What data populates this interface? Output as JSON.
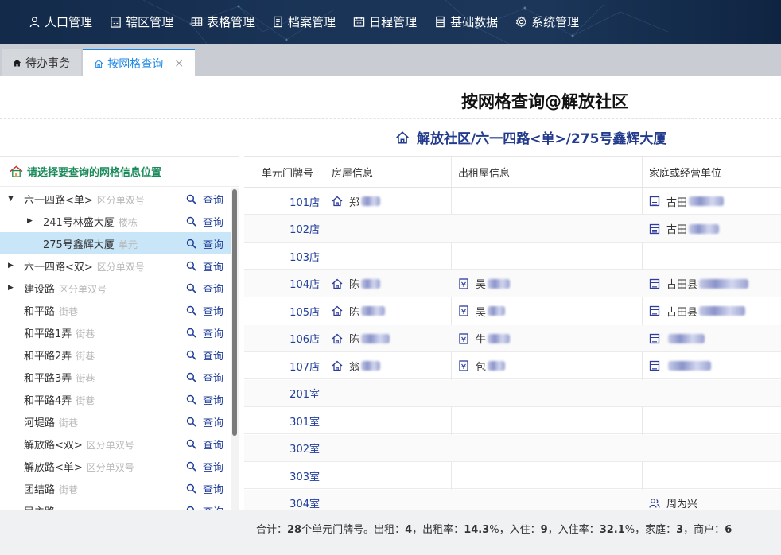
{
  "nav": {
    "items": [
      {
        "label": "人口管理",
        "icon": "person-icon"
      },
      {
        "label": "辖区管理",
        "icon": "building-icon"
      },
      {
        "label": "表格管理",
        "icon": "table-icon"
      },
      {
        "label": "档案管理",
        "icon": "file-icon"
      },
      {
        "label": "日程管理",
        "icon": "calendar-icon"
      },
      {
        "label": "基础数据",
        "icon": "data-icon"
      },
      {
        "label": "系统管理",
        "icon": "gear-icon"
      }
    ]
  },
  "tabs": {
    "home_label": "待办事务",
    "active_label": "按网格查询",
    "close_glyph": "×"
  },
  "page": {
    "title": "按网格查询@解放社区",
    "breadcrumb": "解放社区/六一四路<单>/275号鑫辉大厦"
  },
  "tree": {
    "header": "请选择要查询的网格信息位置",
    "query_label": "查询",
    "items": [
      {
        "name": "六一四路<单>",
        "type": "区分单双号",
        "arrow": "▼",
        "level": 0,
        "selected": false
      },
      {
        "name": "241号林盛大厦",
        "type": "楼栋",
        "arrow": "▶",
        "level": 1,
        "selected": false
      },
      {
        "name": "275号鑫辉大厦",
        "type": "单元",
        "arrow": "",
        "level": 1,
        "selected": true
      },
      {
        "name": "六一四路<双>",
        "type": "区分单双号",
        "arrow": "▶",
        "level": 0,
        "selected": false
      },
      {
        "name": "建设路",
        "type": "区分单双号",
        "arrow": "▶",
        "level": 0,
        "selected": false
      },
      {
        "name": "和平路",
        "type": "街巷",
        "arrow": "",
        "level": 0,
        "selected": false
      },
      {
        "name": "和平路1弄",
        "type": "街巷",
        "arrow": "",
        "level": 0,
        "selected": false
      },
      {
        "name": "和平路2弄",
        "type": "街巷",
        "arrow": "",
        "level": 0,
        "selected": false
      },
      {
        "name": "和平路3弄",
        "type": "街巷",
        "arrow": "",
        "level": 0,
        "selected": false
      },
      {
        "name": "和平路4弄",
        "type": "街巷",
        "arrow": "",
        "level": 0,
        "selected": false
      },
      {
        "name": "河堤路",
        "type": "街巷",
        "arrow": "",
        "level": 0,
        "selected": false
      },
      {
        "name": "解放路<双>",
        "type": "区分单双号",
        "arrow": "",
        "level": 0,
        "selected": false
      },
      {
        "name": "解放路<单>",
        "type": "区分单双号",
        "arrow": "",
        "level": 0,
        "selected": false
      },
      {
        "name": "团结路",
        "type": "街巷",
        "arrow": "",
        "level": 0,
        "selected": false
      },
      {
        "name": "民主路",
        "type": "",
        "arrow": "",
        "level": 0,
        "selected": false
      }
    ]
  },
  "table": {
    "columns": [
      "单元门牌号",
      "房屋信息",
      "出租屋信息",
      "家庭或经营单位"
    ],
    "rows": [
      {
        "door": "101店",
        "house": "郑",
        "rental": "",
        "unit": "古田",
        "unit_icon": "shop-icon"
      },
      {
        "door": "102店",
        "house": "",
        "rental": "",
        "unit": "古田",
        "unit_icon": "shop-icon"
      },
      {
        "door": "103店",
        "house": "",
        "rental": "",
        "unit": "",
        "unit_icon": ""
      },
      {
        "door": "104店",
        "house": "陈",
        "rental": "吴",
        "unit": "古田县",
        "unit_icon": "shop-icon"
      },
      {
        "door": "105店",
        "house": "陈",
        "rental": "吴",
        "unit": "古田县",
        "unit_icon": "shop-icon"
      },
      {
        "door": "106店",
        "house": "陈",
        "rental": "牛",
        "unit": "",
        "unit_icon": "shop-icon"
      },
      {
        "door": "107店",
        "house": "翁",
        "rental": "包",
        "unit": "",
        "unit_icon": "shop-icon"
      },
      {
        "door": "201室",
        "house": "",
        "rental": "",
        "unit": "",
        "unit_icon": ""
      },
      {
        "door": "301室",
        "house": "",
        "rental": "",
        "unit": "",
        "unit_icon": ""
      },
      {
        "door": "302室",
        "house": "",
        "rental": "",
        "unit": "",
        "unit_icon": ""
      },
      {
        "door": "303室",
        "house": "",
        "rental": "",
        "unit": "",
        "unit_icon": ""
      },
      {
        "door": "304室",
        "house": "",
        "rental": "",
        "unit": "周为兴",
        "unit_icon": "family-icon"
      }
    ]
  },
  "summary": {
    "prefix": "合计：",
    "total": "28",
    "t1": "个单元门牌号。出租：",
    "rented": "4",
    "t2": "，出租率：",
    "rent_rate": "14.3",
    "t3": "%，入住：",
    "occupied": "9",
    "t4": "，入住率：",
    "occ_rate": "32.1",
    "t5": "%，家庭：",
    "families": "3",
    "t6": "，商户：",
    "shops": "6"
  },
  "colors": {
    "accent": "#1e88e5",
    "link": "#1f3d99",
    "tree_header": "#1a8a5a",
    "selected_row": "#c8e6f8"
  }
}
